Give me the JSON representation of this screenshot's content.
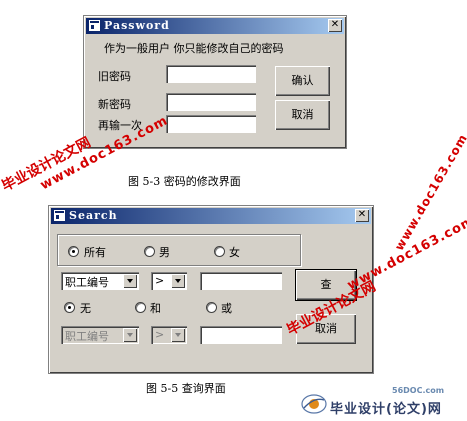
{
  "password_dialog": {
    "title": "Password",
    "close_glyph": "✕",
    "hint": "作为一般用户 你只能修改自己的密码",
    "old_label": "旧密码",
    "new_label": "新密码",
    "confirm_label": "再输一次",
    "ok_label": "确认",
    "cancel_label": "取消"
  },
  "caption1": "图 5-3 密码的修改界面",
  "search_dialog": {
    "title": "Search",
    "close_glyph": "✕",
    "gender_options": [
      "所有",
      "男",
      "女"
    ],
    "field1": "职工编号",
    "op1": ">",
    "logic_options": [
      "无",
      "和",
      "或"
    ],
    "field2": "职工编号",
    "op2": ">",
    "query_label": "查",
    "cancel_label": "取消"
  },
  "caption2": "图 5-5 查询界面",
  "watermarks": {
    "wm1": "毕业设计论文网",
    "wm2": "www.doc163.com",
    "wm3": "www.doc163.com",
    "wm4": "毕业设计论文网",
    "wm5": "www.doc163.com",
    "logo_text": "毕业设计(论文)网",
    "logo_url": "56DOC.com"
  }
}
